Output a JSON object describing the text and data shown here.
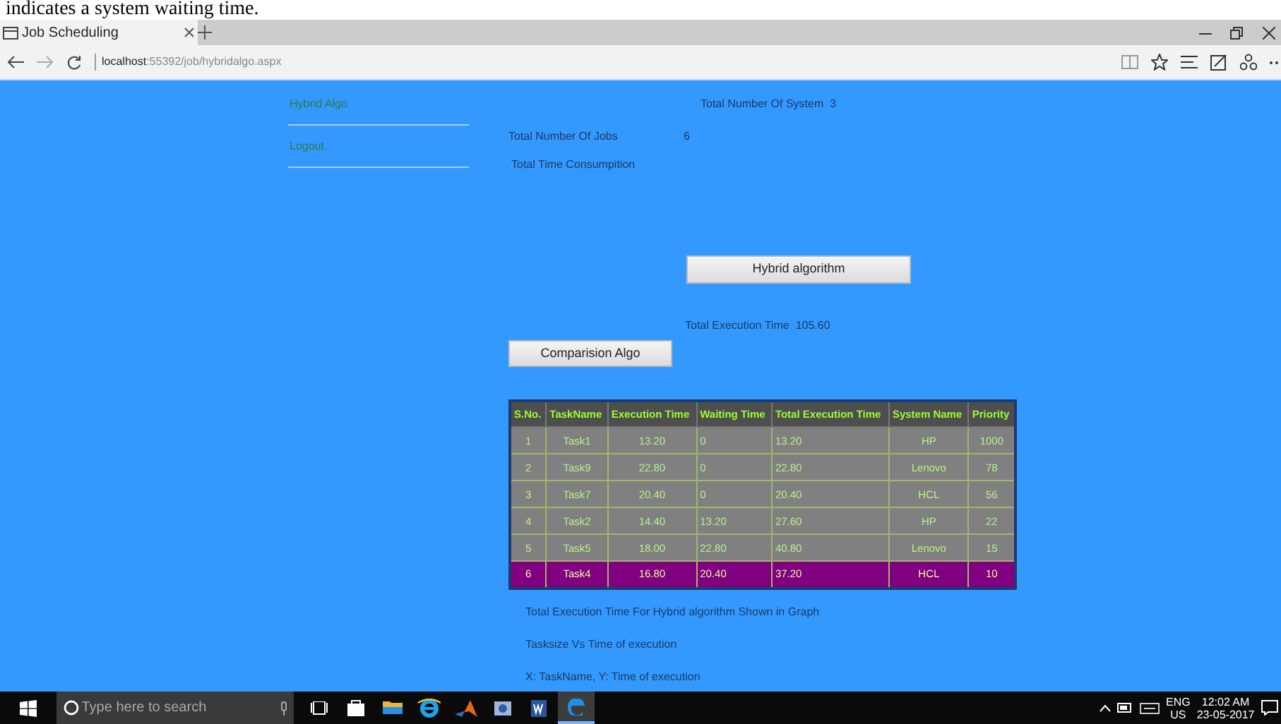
{
  "caption": "indicates a system waiting time.",
  "browser": {
    "tabs": [
      {
        "title": "Job Scheduling",
        "selected": true
      }
    ],
    "address": {
      "host": "localhost",
      "path": ":55392/job/hybridalgo.aspx"
    }
  },
  "sidebar": {
    "items": [
      {
        "label": "Hybrid Algo"
      },
      {
        "label": "Logout"
      }
    ]
  },
  "stats": {
    "systems_label": "Total Number Of System",
    "systems_value": "3",
    "jobs_label": "Total Number Of Jobs",
    "jobs_value": "6",
    "time_label": "Total Time Consumpition"
  },
  "hybrid_button": "Hybrid algorithm",
  "execution": {
    "label": "Total Execution Time",
    "value": "105.60"
  },
  "comparison_button": "Comparision Algo",
  "table": {
    "columns": [
      "S.No.",
      "TaskName",
      "Execution Time",
      "Waiting Time",
      "Total Execution Time",
      "System Name",
      "Priority"
    ],
    "rows": [
      {
        "cells": [
          "1",
          "Task1",
          "13.20",
          "0",
          "13.20",
          "HP",
          "1000"
        ],
        "selected": false
      },
      {
        "cells": [
          "2",
          "Task9",
          "22.80",
          "0",
          "22.80",
          "Lenovo",
          "78"
        ],
        "selected": false
      },
      {
        "cells": [
          "3",
          "Task7",
          "20.40",
          "0",
          "20.40",
          "HCL",
          "56"
        ],
        "selected": false
      },
      {
        "cells": [
          "4",
          "Task2",
          "14.40",
          "13.20",
          "27.60",
          "HP",
          "22"
        ],
        "selected": false
      },
      {
        "cells": [
          "5",
          "Task5",
          "18.00",
          "22.80",
          "40.80",
          "Lenovo",
          "15"
        ],
        "selected": false
      },
      {
        "cells": [
          "6",
          "Task4",
          "16.80",
          "20.40",
          "37.20",
          "HCL",
          "10"
        ],
        "selected": true
      }
    ]
  },
  "notes": [
    "Total  Execution Time For Hybrid algorithm Shown in Graph",
    "Tasksize Vs Time of execution",
    "X: TaskName, Y: Time of execution"
  ],
  "taskbar": {
    "search_placeholder": "Type here to search",
    "apps": [
      {
        "kind": "taskview",
        "active": false
      },
      {
        "kind": "store",
        "active": false
      },
      {
        "kind": "folder",
        "active": false
      },
      {
        "kind": "ie",
        "active": false
      },
      {
        "kind": "matlab",
        "active": false
      },
      {
        "kind": "viewer",
        "active": false
      },
      {
        "kind": "word",
        "active": false
      },
      {
        "kind": "edge",
        "active": true
      }
    ],
    "language": "ENG",
    "region": "US",
    "time": "12:02 AM",
    "date": "23-05-2017"
  }
}
